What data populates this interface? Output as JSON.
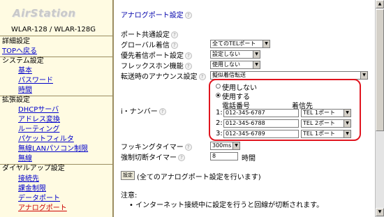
{
  "sidebar": {
    "logo": "AirStation",
    "model": "WLAR-128 / WLAR-128G",
    "items": [
      {
        "label": "詳細設定",
        "kind": "head"
      },
      {
        "label": "TOPへ戻る",
        "kind": "link"
      },
      {
        "label": "システム設定",
        "kind": "head"
      },
      {
        "label": "基本",
        "kind": "sub"
      },
      {
        "label": "パスワード",
        "kind": "sub"
      },
      {
        "label": "時間",
        "kind": "sub"
      },
      {
        "label": "拡張設定",
        "kind": "head"
      },
      {
        "label": "DHCPサーバ",
        "kind": "sub"
      },
      {
        "label": "アドレス変換",
        "kind": "sub"
      },
      {
        "label": "ルーティング",
        "kind": "sub"
      },
      {
        "label": "パケットフィルタ",
        "kind": "sub"
      },
      {
        "label": "無線LANパソコン制限",
        "kind": "sub"
      },
      {
        "label": "無線",
        "kind": "sub"
      },
      {
        "label": "ダイヤルアップ設定",
        "kind": "head"
      },
      {
        "label": "接続先",
        "kind": "sub"
      },
      {
        "label": "課金制限",
        "kind": "sub"
      },
      {
        "label": "データポート",
        "kind": "sub"
      },
      {
        "label": "アナログポート",
        "kind": "sub",
        "active": true
      }
    ]
  },
  "main": {
    "title": "アナログポート設定",
    "section": "ポート共通設定",
    "global_incoming": {
      "label": "グローバル着信",
      "value": "全てのTELポート"
    },
    "priority_port": {
      "label": "優先着信ポート設定",
      "value": "設定しない"
    },
    "flex_phone": {
      "label": "フレックスホン機能",
      "value": "使用しない"
    },
    "transfer_announce": {
      "label": "転送時のアナウンス設定",
      "value": "擬似着信転送"
    },
    "i_number": {
      "label": "i・ナンバー",
      "option_off": "使用しない",
      "option_on": "使用する",
      "selected": "使用する",
      "col_phone": "電話番号",
      "col_dest": "着信先",
      "rows": [
        {
          "index": "1:",
          "number": "012-345-6787",
          "dest": "TEL 1ポート"
        },
        {
          "index": "2:",
          "number": "012-345-6788",
          "dest": "TEL 2ポート"
        },
        {
          "index": "3:",
          "number": "012-345-6789",
          "dest": "TEL 1ポート"
        }
      ]
    },
    "hooking_timer": {
      "label": "フッキングタイマー",
      "value": "300ms"
    },
    "forced_timer": {
      "label": "強制切断タイマー",
      "value": "8",
      "unit": "時間"
    },
    "apply_button": "設定",
    "apply_note": "(全てのアナログポート設定を行います)",
    "note_title": "注意:",
    "notes": [
      "インターネット接続中に設定を行うと回線が切断されます。"
    ]
  },
  "colors": {
    "sidebar_bg": "#fffbe2",
    "sidebar_border": "#9b8d61",
    "link": "#0000cc",
    "active_link": "#cc0000",
    "title": "#0000aa",
    "highlight": "#e0141e"
  },
  "icons": {
    "help": "help-icon",
    "dropdown": "chevron-down-icon",
    "scroll_up": "scroll-up-icon",
    "scroll_down": "scroll-down-icon"
  }
}
